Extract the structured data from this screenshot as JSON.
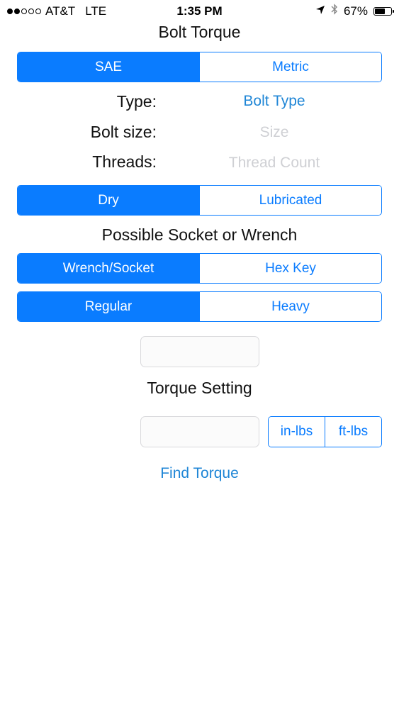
{
  "status_bar": {
    "carrier": "AT&T",
    "network": "LTE",
    "time": "1:35 PM",
    "battery_percent": "67%",
    "battery_level": 0.67,
    "signal_strength": 2,
    "signal_max": 5,
    "icons": [
      "location-arrow-icon",
      "bluetooth-icon",
      "battery-icon"
    ]
  },
  "nav": {
    "title": "Bolt Torque"
  },
  "unit_system": {
    "options": [
      "SAE",
      "Metric"
    ],
    "selected": "SAE"
  },
  "form": {
    "type_label": "Type:",
    "type_value": "Bolt Type",
    "size_label": "Bolt size:",
    "size_placeholder": "Size",
    "threads_label": "Threads:",
    "threads_placeholder": "Thread Count"
  },
  "condition": {
    "options": [
      "Dry",
      "Lubricated"
    ],
    "selected": "Dry"
  },
  "socket_section": {
    "title": "Possible Socket or Wrench",
    "tool": {
      "options": [
        "Wrench/Socket",
        "Hex Key"
      ],
      "selected": "Wrench/Socket"
    },
    "duty": {
      "options": [
        "Regular",
        "Heavy"
      ],
      "selected": "Regular"
    },
    "result_value": ""
  },
  "torque_section": {
    "title": "Torque Setting",
    "result_value": "",
    "units": {
      "options": [
        "in-lbs",
        "ft-lbs"
      ],
      "selected": ""
    }
  },
  "actions": {
    "find_torque": "Find Torque"
  },
  "colors": {
    "accent": "#0a7cff",
    "link": "#1f86d6",
    "placeholder": "#cfd0d4"
  }
}
